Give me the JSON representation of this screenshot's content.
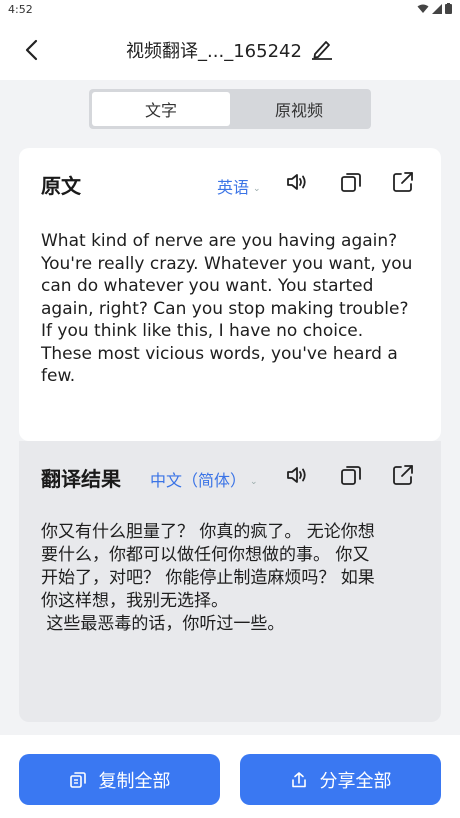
{
  "status": {
    "time": "4:52"
  },
  "header": {
    "title": "视频翻译_..._165242"
  },
  "tabs": [
    {
      "label": "文字",
      "active": true
    },
    {
      "label": "原视频",
      "active": false
    }
  ],
  "source": {
    "label": "原文",
    "language": "英语",
    "lines": [
      "What kind of nerve are you having again?",
      "You're really crazy.  Whatever you want, you",
      "can do whatever you want.  You started",
      "again, right?  Can you stop making trouble?",
      "If you think like this, I have no choice.",
      "These most vicious words,  you've heard a",
      "few."
    ]
  },
  "result": {
    "label": "翻译结果",
    "language": "中文（简体）",
    "lines": [
      "你又有什么胆量了？ 你真的疯了。 无论你想",
      "要什么，你都可以做任何你想做的事。 你又",
      "开始了，对吧？ 你能停止制造麻烦吗？ 如果",
      "你这样想，我别无选择。",
      " 这些最恶毒的话，你听过一些。"
    ]
  },
  "actions": {
    "copy_all": "复制全部",
    "share_all": "分享全部"
  },
  "colors": {
    "accent": "#3a78f2",
    "link": "#3b74e6"
  }
}
